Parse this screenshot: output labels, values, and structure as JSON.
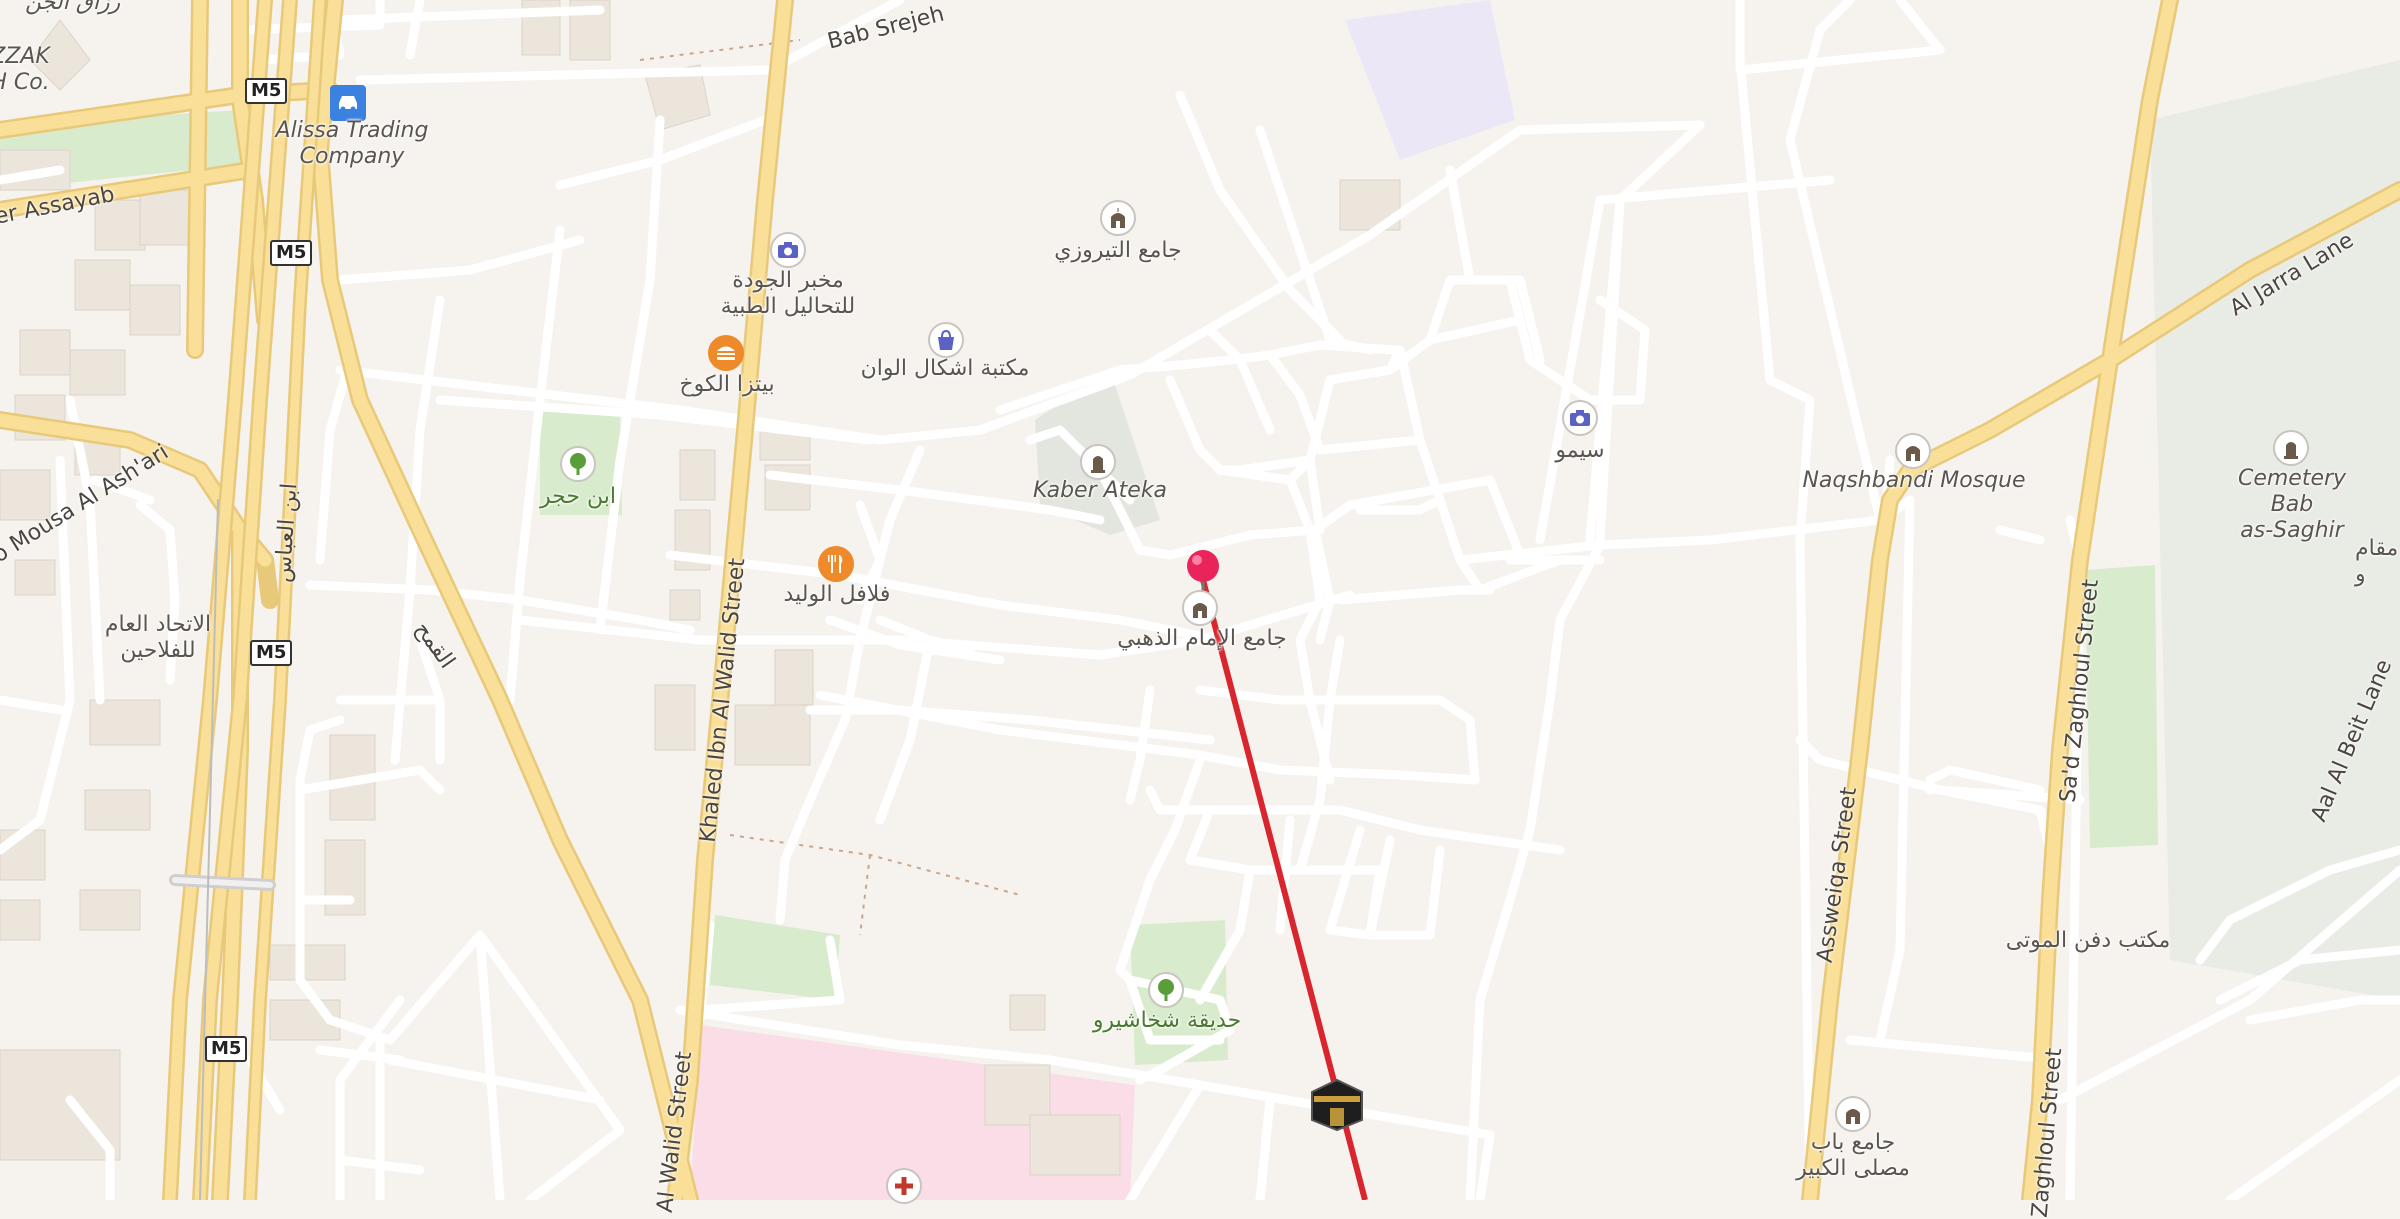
{
  "map": {
    "labels": {
      "bab_srejeh": "Bab Srejeh",
      "alissa": "Alissa Trading\nCompany",
      "zzak": "ZZAK\nH Co.",
      "razzak_ar": "رزاق الجن",
      "er_assayab": "er Assayab",
      "mousa": "o Mousa Al Ash'ari",
      "ibn_alabbas": "ابن العباس",
      "ittihad": "الاتحاد العام\nللفلاحين",
      "ibn_hajar": "ابن حجر",
      "lab": "مخبر الجودة\nللتحاليل الطبية",
      "pizza": "بيتزا الكوخ",
      "bookshop": "مكتبة اشكال الوان",
      "tirouzi": "جامع التيروزي",
      "kaber_ateka": "Kaber Ateka",
      "falafel": "فلافل الوليد",
      "golden_mosque": "جامع الإمام الذهبي",
      "simo": "سيمو",
      "naqshbandi": "Naqshbandi Mosque",
      "cemetery": "Cemetery Bab\nas-Saghir",
      "maqam": "مقام\nو",
      "garden": "حديقة شخاشيرو",
      "funeral": "مكتب دفن الموتى",
      "bab_musalla": "جامع باب\nمصلى الكبير",
      "khaled": "Khaled Ibn Al Walid Street",
      "walid_street": "Al Walid Street",
      "assweiqa": "Assweiqa Street",
      "zaghloul": "Sa'd Zaghloul Street",
      "zaghloul2": "Zaghloul Street",
      "al_jarra": "Al Jarra Lane",
      "aal_beit": "Aal Al Beit Lane",
      "qamah": "القمح",
      "m5": "M5"
    },
    "icons": {
      "pin": "map-pin-icon",
      "kaaba": "kaaba-icon",
      "route_color": "#d9262e",
      "pin_color": "#e8245a"
    }
  }
}
